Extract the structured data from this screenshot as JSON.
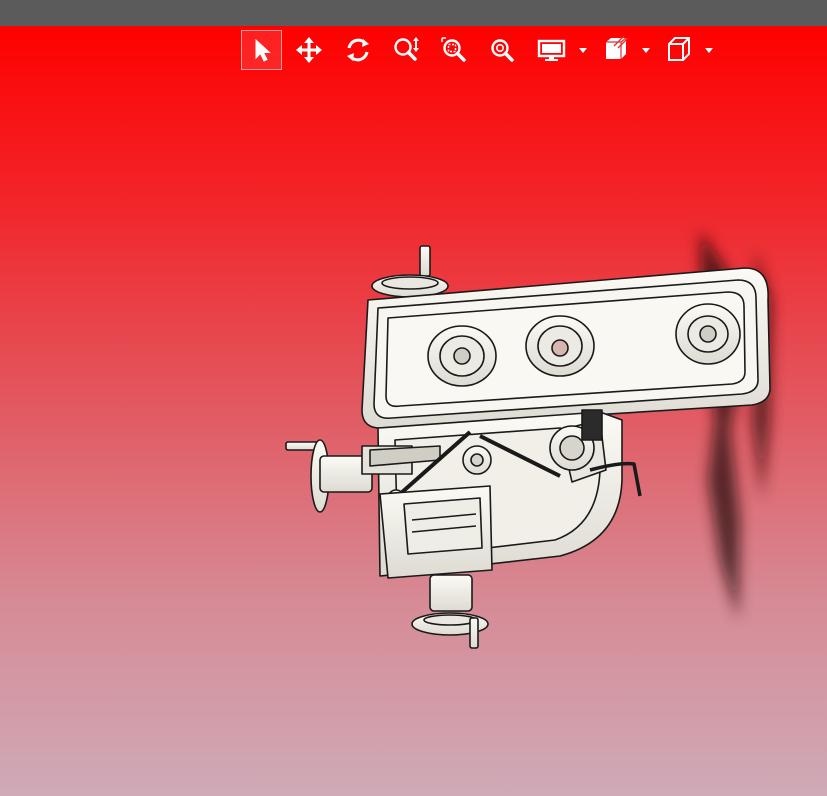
{
  "colors": {
    "titlebar": "#5b5b5b",
    "viewport_top": "#ff0000",
    "viewport_bottom": "#cfaab7",
    "icon": "#ffffff",
    "model_fill": "#f4f2ea",
    "model_stroke": "#1a1a1a"
  },
  "toolbar": {
    "tools": [
      {
        "name": "select",
        "icon": "cursor-arrow-icon",
        "active": true
      },
      {
        "name": "pan",
        "icon": "move-arrows-icon",
        "active": false
      },
      {
        "name": "rotate",
        "icon": "rotate-icon",
        "active": false
      },
      {
        "name": "zoom",
        "icon": "zoom-updown-icon",
        "active": false
      },
      {
        "name": "zoom-window",
        "icon": "zoom-box-icon",
        "active": false
      },
      {
        "name": "zoom-fit",
        "icon": "zoom-fit-icon",
        "active": false
      },
      {
        "name": "display-mode",
        "icon": "monitor-icon",
        "has_dropdown": true
      },
      {
        "name": "section-view",
        "icon": "section-cube-icon",
        "has_dropdown": true
      },
      {
        "name": "view-orientation",
        "icon": "view-cube-icon",
        "has_dropdown": true
      }
    ]
  },
  "viewport": {
    "model": "drill-press-head-assembly"
  }
}
